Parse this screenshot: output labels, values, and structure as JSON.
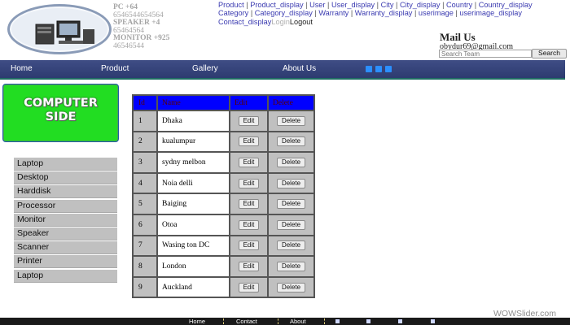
{
  "header": {
    "specs": [
      {
        "label": "PC +64",
        "bold": true
      },
      {
        "label": "6546544654564",
        "bold": false
      },
      {
        "label": "SPEAKER +4",
        "bold": true
      },
      {
        "label": "65464564",
        "bold": false
      },
      {
        "label": "MONITOR +925",
        "bold": true
      },
      {
        "label": "46546544",
        "bold": false
      }
    ],
    "nav_links": [
      "Product",
      "Product_display",
      "User",
      "User_display",
      "City",
      "City_display",
      "Country",
      "Country_display",
      "Category",
      "Category_display",
      "Warranty",
      "Warranty_display",
      "userimage",
      "userimage_display",
      "Contact_display"
    ],
    "login": "Login",
    "logout": "Logout",
    "mail_title": "Mail Us",
    "email": "obydur69@gmail.com",
    "search_placeholder": "Search Team",
    "search_button": "Search"
  },
  "mainnav": {
    "items": [
      "Home",
      "Product",
      "Gallery",
      "About Us"
    ],
    "social_icons": [
      "linkedin-icon",
      "twitter-icon",
      "facebook-icon"
    ],
    "color": "#334278"
  },
  "brand": {
    "line1": "COMPUTER",
    "line2": "SIDE",
    "color": "#22dd22"
  },
  "sidebar": {
    "items": [
      "Laptop",
      "Desktop",
      "Harddisk",
      "Processor",
      "Monitor",
      "Speaker",
      "Scanner",
      "Printer",
      "Laptop"
    ]
  },
  "table": {
    "headers": [
      "Id",
      "Name",
      "Edit",
      "Delete"
    ],
    "edit_label": "Edit",
    "delete_label": "Delete",
    "rows": [
      {
        "id": "1",
        "name": "Dhaka"
      },
      {
        "id": "2",
        "name": "kualumpur"
      },
      {
        "id": "3",
        "name": "sydny melbon"
      },
      {
        "id": "4",
        "name": "Noia delli"
      },
      {
        "id": "5",
        "name": "Baiging"
      },
      {
        "id": "6",
        "name": "Otoa"
      },
      {
        "id": "7",
        "name": "Wasing ton DC"
      },
      {
        "id": "8",
        "name": "London"
      },
      {
        "id": "9",
        "name": "Auckland"
      }
    ],
    "header_color": "#0000ff"
  },
  "footer": {
    "items": [
      "Home",
      "Contact",
      "About"
    ],
    "icons": [
      "facebook-icon",
      "twitter-icon",
      "googleplus-icon",
      "linkedin-icon",
      "chat-icon"
    ]
  },
  "watermark": "WOWSlider.com"
}
